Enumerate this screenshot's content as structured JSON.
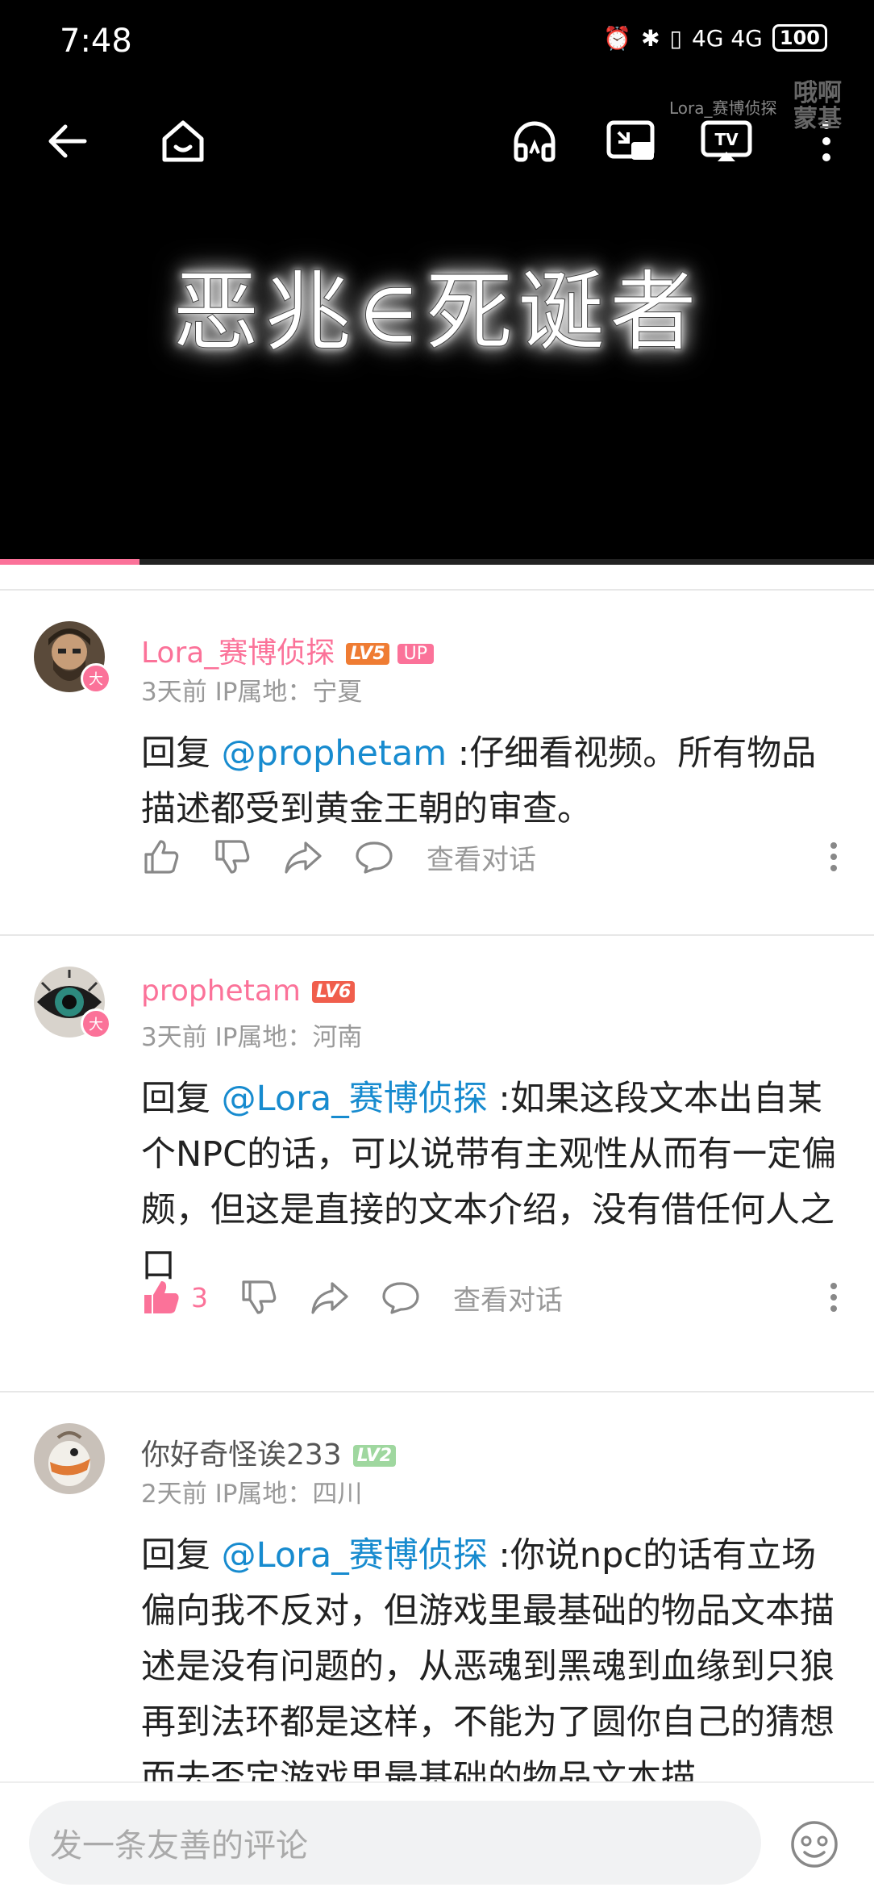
{
  "status_bar": {
    "time": "7:48",
    "network": "4G 4G",
    "battery": "100"
  },
  "video": {
    "title": "恶兆∈死诞者",
    "watermark_name": "Lora_赛博侦探",
    "watermark_logo_line1": "哦",
    "watermark_logo_line2": "啊",
    "watermark_logo_line3": "蒙基",
    "progress_fraction": 0.16,
    "progress_color": "#fb7299"
  },
  "comments": [
    {
      "username": "Lora_赛博侦探",
      "level": "LV5",
      "level_color": "#ef7c33",
      "is_up": true,
      "up_label": "UP",
      "badge": "大",
      "meta": "3天前  IP属地：宁夏",
      "reply_prefix": "回复 ",
      "mention": "@prophetam",
      "text": " :仔细看视频。所有物品描述都受到黄金王朝的审查。",
      "like_count": "",
      "liked": false,
      "view_conversation": "查看对话"
    },
    {
      "username": "prophetam",
      "level": "LV6",
      "level_color": "#f05e4c",
      "is_up": false,
      "badge": "大",
      "meta": "3天前  IP属地：河南",
      "reply_prefix": "回复 ",
      "mention": "@Lora_赛博侦探",
      "text": " :如果这段文本出自某个NPC的话，可以说带有主观性从而有一定偏颇，但这是直接的文本介绍，没有借任何人之口",
      "like_count": "3",
      "liked": true,
      "view_conversation": "查看对话"
    },
    {
      "username": "你好奇怪诶233",
      "level": "LV2",
      "level_color": "#9fd79f",
      "is_up": false,
      "badge": "",
      "meta": "2天前  IP属地：四川",
      "reply_prefix": "回复 ",
      "mention": "@Lora_赛博侦探",
      "text": " :你说npc的话有立场偏向我不反对，但游戏里最基础的物品文本描述是没有问题的，从恶魂到黑魂到血缘到只狼再到法环都是这样，不能为了圆你自己的猜想而去否定游戏里最基础的物品文本描",
      "like_count": "",
      "liked": false,
      "view_conversation": ""
    }
  ],
  "input": {
    "placeholder": "发一条友善的评论"
  },
  "icons": {
    "back": "back-arrow-icon",
    "home": "home-icon",
    "headphones": "headphones-icon",
    "pip": "picture-in-picture-icon",
    "cast": "tv-cast-icon",
    "more": "more-vertical-icon",
    "emoji": "emoji-icon"
  }
}
